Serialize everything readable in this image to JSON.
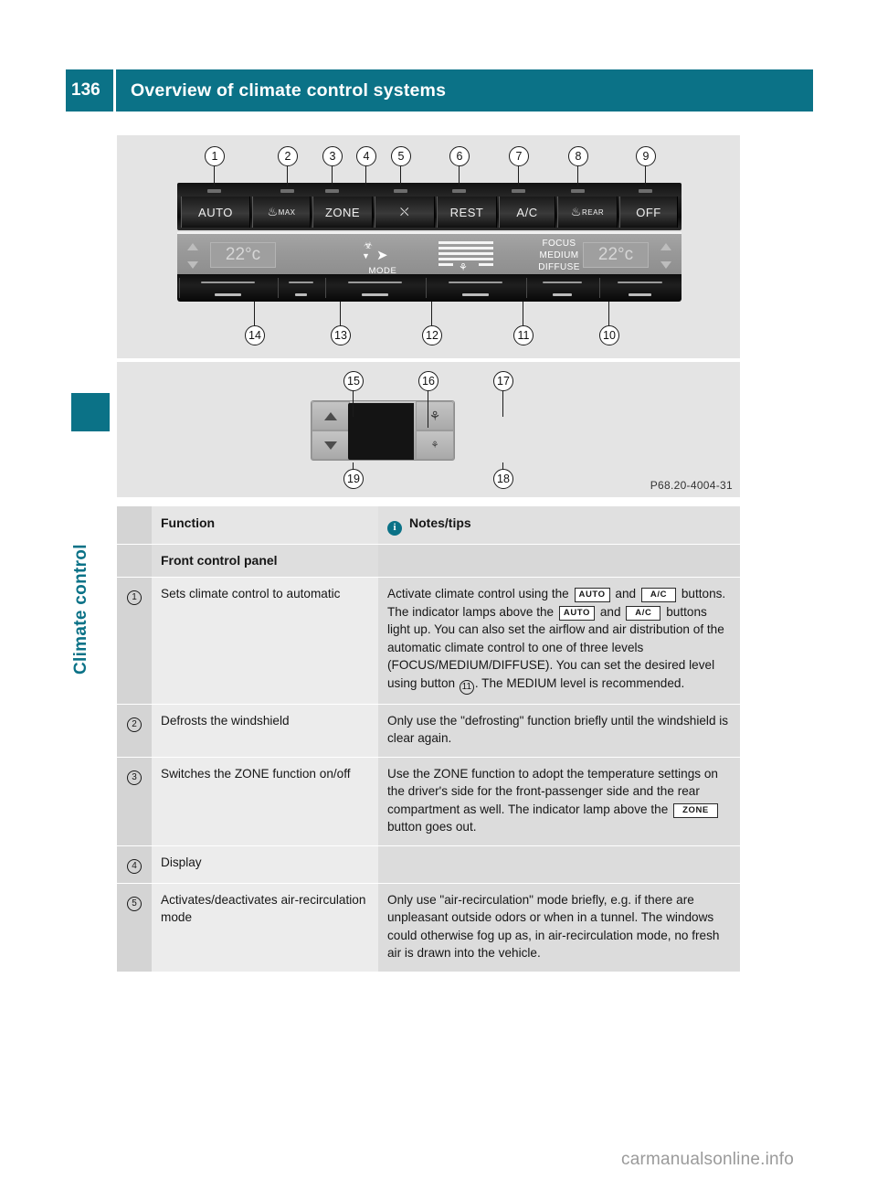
{
  "header": {
    "page_number": "136",
    "title": "Overview of climate control systems"
  },
  "sidebar": {
    "chapter_label": "Climate control"
  },
  "figures": {
    "front_panel": {
      "caption_code": "",
      "top_callouts": [
        "1",
        "2",
        "3",
        "4",
        "5",
        "6",
        "7",
        "8",
        "9"
      ],
      "bottom_callouts": [
        "14",
        "13",
        "12",
        "11",
        "10"
      ],
      "buttons": [
        {
          "label": "AUTO",
          "sup": ""
        },
        {
          "label": "♨",
          "sup": "MAX"
        },
        {
          "label": "ZONE",
          "sup": ""
        },
        {
          "label": "⛌",
          "sup": ""
        },
        {
          "label": "REST",
          "sup": ""
        },
        {
          "label": "A/C",
          "sup": ""
        },
        {
          "label": "♨",
          "sup": "REAR"
        },
        {
          "label": "OFF",
          "sup": ""
        }
      ],
      "display": {
        "left_temperature": "22°c",
        "right_temperature": "22°c",
        "mode_label": "MODE",
        "airflow_levels": [
          "FOCUS",
          "MEDIUM",
          "DIFFUSE"
        ]
      }
    },
    "rear_panel": {
      "top_callouts": [
        "15",
        "16",
        "17"
      ],
      "bottom_callouts": [
        "19",
        "18"
      ],
      "image_code": "P68.20-4004-31"
    }
  },
  "table": {
    "headers": {
      "number": "",
      "function": "Function",
      "notes": "Notes/tips",
      "notes_icon": "info-icon"
    },
    "section_title": "Front control panel",
    "rows": [
      {
        "number": "1",
        "function": "Sets climate control to automatic",
        "notes_parts": [
          {
            "type": "text",
            "value": "Activate climate control using the "
          },
          {
            "type": "key",
            "value": "AUTO"
          },
          {
            "type": "text",
            "value": " and "
          },
          {
            "type": "key-wide",
            "value": "A/C"
          },
          {
            "type": "text",
            "value": " buttons. The indicator lamps above the "
          },
          {
            "type": "key",
            "value": "AUTO"
          },
          {
            "type": "text",
            "value": " and "
          },
          {
            "type": "key-wide",
            "value": "A/C"
          },
          {
            "type": "text",
            "value": " buttons light up. You can also set the airflow and air distribution of the automatic climate control to one of three levels (FOCUS/MEDIUM/DIFFUSE). You can set the desired level using button "
          },
          {
            "type": "circle",
            "value": "11"
          },
          {
            "type": "text",
            "value": ". The MEDIUM level is recommended."
          }
        ]
      },
      {
        "number": "2",
        "function": "Defrosts the windshield",
        "notes_parts": [
          {
            "type": "text",
            "value": "Only use the \"defrosting\" function briefly until the windshield is clear again."
          }
        ]
      },
      {
        "number": "3",
        "function": "Switches the ZONE function on/off",
        "notes_parts": [
          {
            "type": "text",
            "value": "Use the ZONE function to adopt the temperature settings on the driver's side for the front-passenger side and the rear compartment as well. The indicator lamp above the "
          },
          {
            "type": "key-wide",
            "value": "ZONE"
          },
          {
            "type": "text",
            "value": " button goes out."
          }
        ]
      },
      {
        "number": "4",
        "function": "Display",
        "notes_parts": []
      },
      {
        "number": "5",
        "function": "Activates/deactivates air-recirculation mode",
        "notes_parts": [
          {
            "type": "text",
            "value": "Only use \"air-recirculation\" mode briefly, e.g. if there are unpleasant outside odors or when in a tunnel. The windows could otherwise fog up as, in air-recirculation mode, no fresh air is drawn into the vehicle."
          }
        ]
      }
    ]
  },
  "watermark": "carmanualsonline.info",
  "colors": {
    "accent": "#0b7287",
    "header_text": "#ffffff",
    "figure_bg": "#e4e4e4"
  }
}
